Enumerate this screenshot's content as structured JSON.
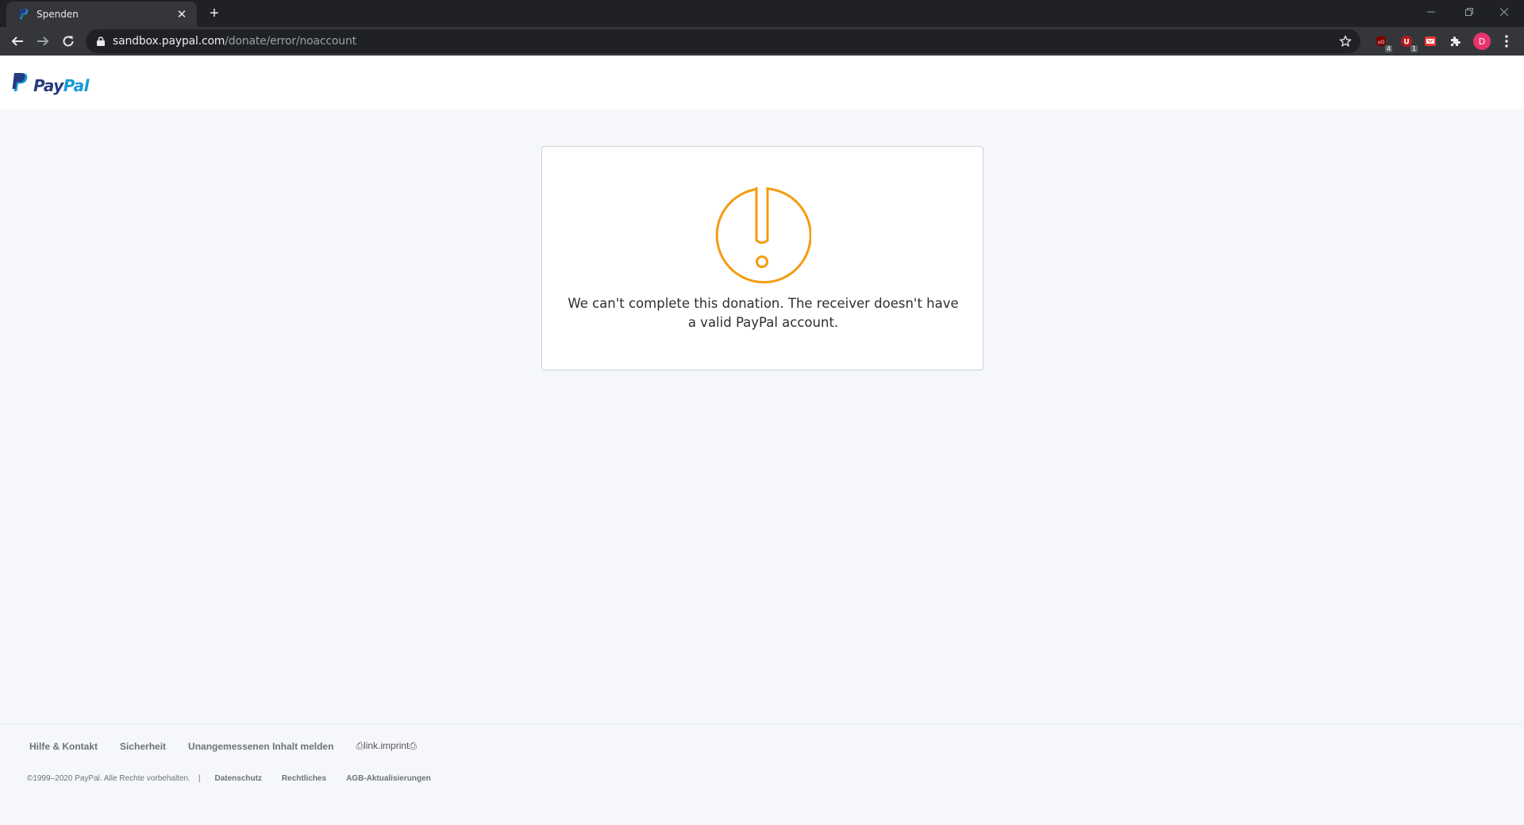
{
  "browser": {
    "tab_title": "Spenden",
    "new_tab_symbol": "+",
    "url_host": "sandbox.paypal.com",
    "url_path": "/donate/error/noaccount",
    "extensions": [
      {
        "name": "ublock-extension",
        "badge": "4"
      },
      {
        "name": "ublock-secondary-extension",
        "badge": "1"
      },
      {
        "name": "pdf-extension",
        "badge": ""
      }
    ],
    "profile_initial": "D"
  },
  "page": {
    "logo": {
      "pay": "Pay",
      "pal": "Pal"
    },
    "error_message": "We can't complete this donation. The receiver doesn't have a valid PayPal account.",
    "accent_color": "#f39c12"
  },
  "footer": {
    "links": [
      "Hilfe & Kontakt",
      "Sicherheit",
      "Unangemessenen Inhalt melden",
      "⎙link.imprint⎙"
    ],
    "copyright": "©1999–2020  PayPal. Alle Rechte vorbehalten.",
    "separator": "|",
    "legal_links": [
      "Datenschutz",
      "Rechtliches",
      "AGB-Aktualisierungen"
    ]
  }
}
